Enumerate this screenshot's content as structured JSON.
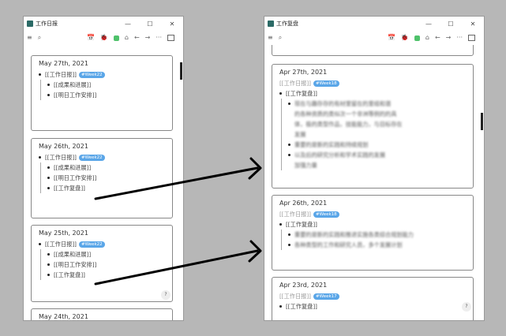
{
  "left_window": {
    "title": "工作日报",
    "controls": {
      "minimize": "—",
      "maximize": "☐",
      "close": "✕"
    },
    "toolbar": {
      "menu": "≡",
      "search": "⌕",
      "calendar": "📅",
      "bug": "🐞",
      "home": "⌂",
      "back": "←",
      "forward": "→",
      "more": "···"
    },
    "cards": [
      {
        "date": "May 27th, 2021",
        "journal": "[[工作日报]]",
        "tag": "#Week22",
        "items": [
          "[[成果和进展]]",
          "[[明日工作安排]]"
        ]
      },
      {
        "date": "May 26th, 2021",
        "journal": "[[工作日报]]",
        "tag": "#Week22",
        "items": [
          "[[成果和进展]]",
          "[[明日工作安排]]",
          "[[工作复盘]]"
        ]
      },
      {
        "date": "May 25th, 2021",
        "journal": "[[工作日报]]",
        "tag": "#Week22",
        "items": [
          "[[成果和进展]]",
          "[[明日工作安排]]",
          "[[工作复盘]]"
        ]
      },
      {
        "date": "May 24th, 2021"
      }
    ],
    "help": "?"
  },
  "right_window": {
    "title": "工作复盘",
    "controls": {
      "minimize": "—",
      "maximize": "☐",
      "close": "✕"
    },
    "toolbar": {
      "menu": "≡",
      "search": "⌕",
      "calendar": "📅",
      "bug": "🐞",
      "home": "⌂",
      "back": "←",
      "forward": "→",
      "more": "···"
    },
    "cards": [
      {
        "date": "Apr 27th, 2021",
        "ref": "[[工作日报]]",
        "tag": "#Week18",
        "parent": "[[工作复盘]]",
        "blurred": [
          "现在与趣存存的有材里留在的里组和谐",
          "的各种资质的类似次一个非洲等例的的具",
          "体，极的类型作品，技能能力，与目标存在",
          "发展",
          "重要的是新的实践和持续规划",
          "以及后的研究分析和学术实践的发展",
          "加强力量"
        ]
      },
      {
        "date": "Apr 26th, 2021",
        "ref": "[[工作日报]]",
        "tag": "#Week18",
        "parent": "[[工作复盘]]",
        "blurred": [
          "重要的是新的实践和推进实施各类综合规划能力",
          "各种类型的工作和研究人员，多个发展计划"
        ]
      },
      {
        "date": "Apr 23rd, 2021",
        "ref": "[[工作日报]]",
        "tag": "#Week17",
        "parent": "[[工作复盘]]"
      }
    ],
    "help": "?"
  },
  "colors": {
    "background": "#b7b7b7",
    "tag": "#5aa6e8",
    "green_icon": "#4fc26b",
    "arrow": "#000000"
  }
}
